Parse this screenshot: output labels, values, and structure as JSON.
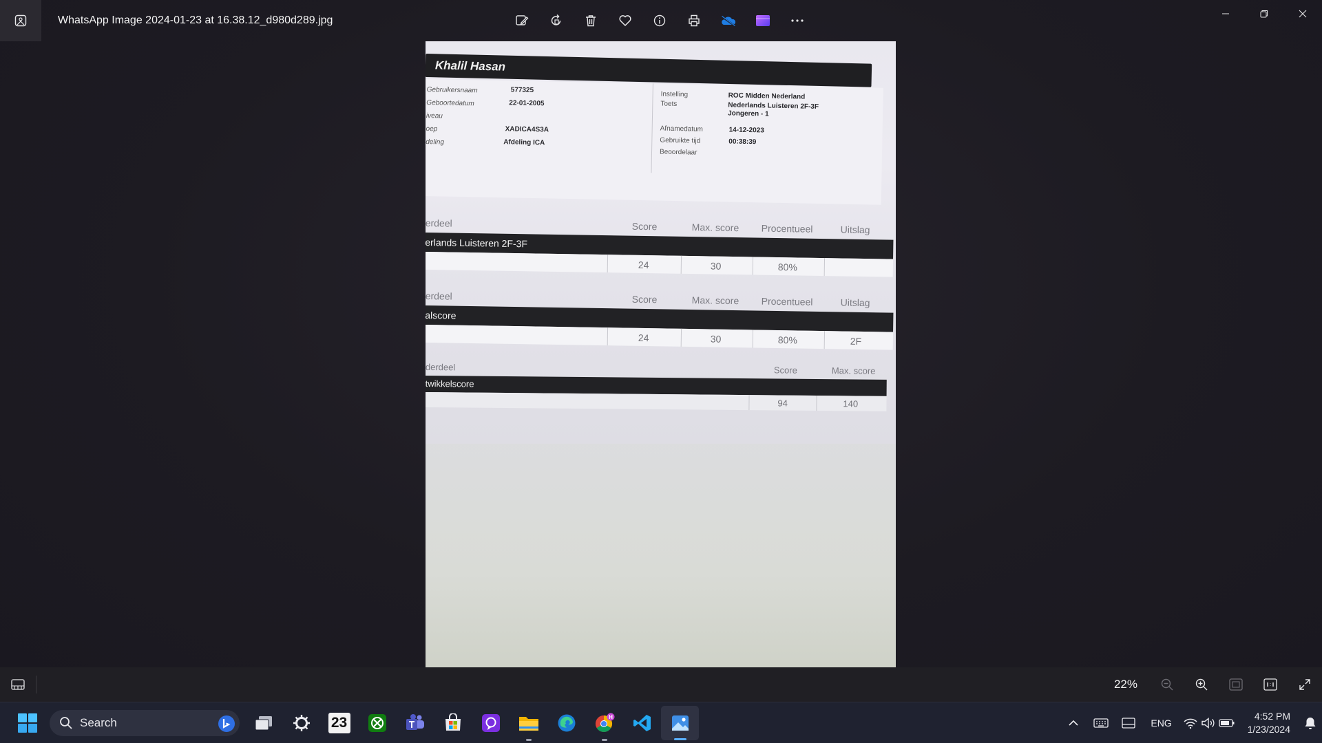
{
  "window": {
    "title": "WhatsApp Image 2024-01-23 at 16.38.12_d980d289.jpg"
  },
  "toolbar": {
    "icons": [
      "edit-image-icon",
      "rotate-icon",
      "delete-icon",
      "favorite-icon",
      "info-icon",
      "print-icon",
      "onedrive-icon",
      "clipchamp-icon",
      "more-icon"
    ]
  },
  "photo": {
    "name": "Khalil Hasan",
    "left_fields": [
      {
        "label": "Gebruikersnaam",
        "value": "577325"
      },
      {
        "label": "Geboortedatum",
        "value": "22-01-2005"
      },
      {
        "label": "iveau",
        "value": ""
      },
      {
        "label": "oep",
        "value": "XADICA4S3A"
      },
      {
        "label": "deling",
        "value": "Afdeling ICA"
      }
    ],
    "right_fields": [
      {
        "label": "Instelling",
        "value": "ROC Midden Nederland"
      },
      {
        "label": "Toets",
        "value": "Nederlands Luisteren 2F-3F Jongeren - 1"
      },
      {
        "label": "Afnamedatum",
        "value": "14-12-2023"
      },
      {
        "label": "Gebruikte tijd",
        "value": "00:38:39"
      },
      {
        "label": "Beoordelaar",
        "value": ""
      }
    ],
    "section1": {
      "col_header": "erdeel",
      "score_label": "Score",
      "max_label": "Max. score",
      "pct_label": "Procentueel",
      "result_label": "Uitslag",
      "bar": "erlands Luisteren 2F-3F",
      "score": "24",
      "max": "30",
      "pct": "80%",
      "result": ""
    },
    "section2": {
      "col_header": "erdeel",
      "score_label": "Score",
      "max_label": "Max. score",
      "pct_label": "Procentueel",
      "result_label": "Uitslag",
      "bar": "alscore",
      "score": "24",
      "max": "30",
      "pct": "80%",
      "result": "2F"
    },
    "section3": {
      "col_header": "derdeel",
      "score_label": "Score",
      "max_label": "Max. score",
      "bar": "twikkelscore",
      "score": "94",
      "max": "140"
    }
  },
  "statusbar": {
    "zoom": "22%"
  },
  "taskbar": {
    "search_placeholder": "Search",
    "apps": [
      "task-view-icon",
      "steelseries-icon",
      "calendar-23-icon",
      "xbox-icon",
      "teams-icon",
      "microsoft-store-icon",
      "app-icon",
      "file-explorer-icon",
      "edge-icon",
      "chrome-icon",
      "vscode-icon",
      "photos-icon"
    ],
    "calendar_day": "23",
    "language": "ENG",
    "time": "4:52 PM",
    "date": "1/23/2024"
  },
  "colors": {
    "accent": "#5ab0ff",
    "taskbar_bg": "#1f2230",
    "app_bg": "#1d1b22"
  }
}
